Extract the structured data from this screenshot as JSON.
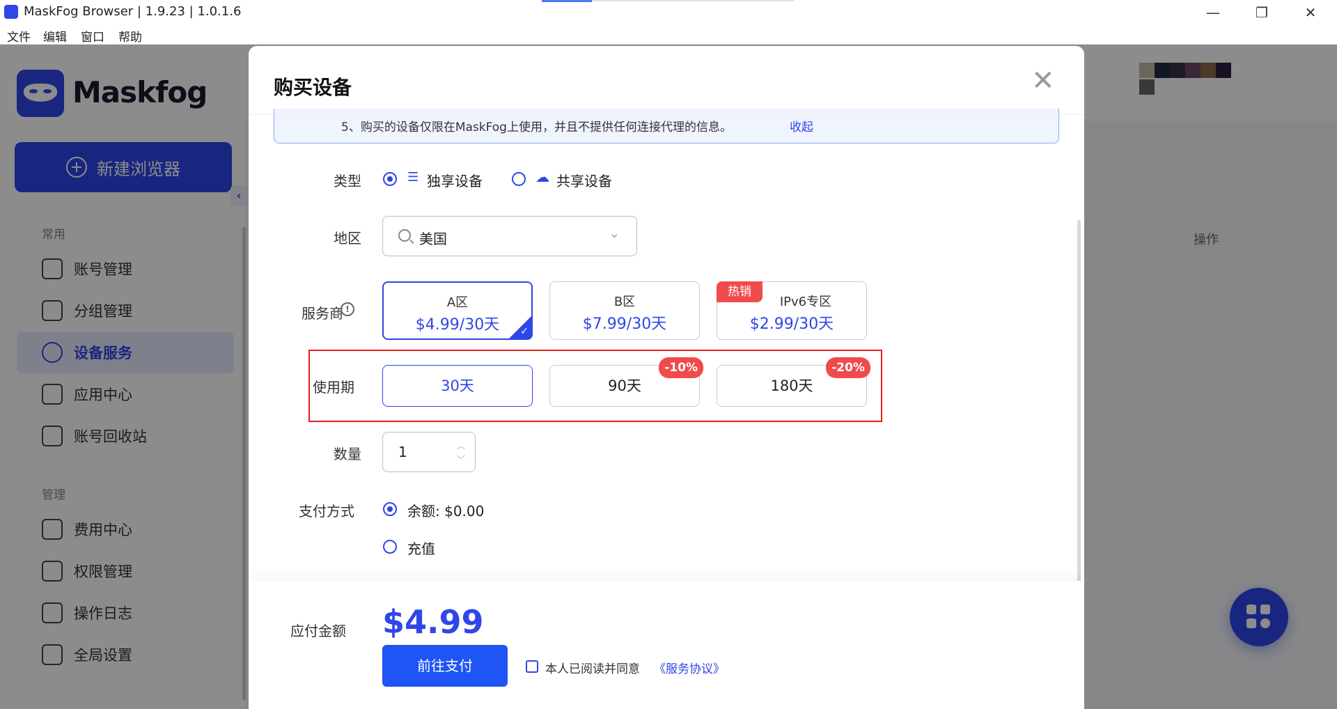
{
  "window": {
    "title": "MaskFog Browser | 1.9.23 | 1.0.1.6",
    "minimize_icon": "minimize-icon",
    "maximize_icon": "restore-icon",
    "close_icon": "close-icon"
  },
  "menu": [
    "文件",
    "编辑",
    "窗口",
    "帮助"
  ],
  "sidebar": {
    "logo": "Maskfog",
    "new_button": "新建浏览器",
    "sections": [
      {
        "title": "常用",
        "items": [
          {
            "label": "账号管理",
            "icon": "account-list-icon",
            "active": false
          },
          {
            "label": "分组管理",
            "icon": "folder-icon",
            "active": false
          },
          {
            "label": "设备服务",
            "icon": "location-pin-icon",
            "active": true
          },
          {
            "label": "应用中心",
            "icon": "cube-icon",
            "active": false
          },
          {
            "label": "账号回收站",
            "icon": "trash-icon",
            "active": false
          }
        ]
      },
      {
        "title": "管理",
        "items": [
          {
            "label": "费用中心",
            "icon": "receipt-dollar-icon",
            "active": false
          },
          {
            "label": "权限管理",
            "icon": "shield-key-icon",
            "active": false
          },
          {
            "label": "操作日志",
            "icon": "clipboard-icon",
            "active": false
          },
          {
            "label": "全局设置",
            "icon": "settings-hex-icon",
            "active": false
          }
        ]
      }
    ]
  },
  "main": {
    "table_op_header": "操作"
  },
  "modal": {
    "title": "购买设备",
    "notice": "5、购买的设备仅限在MaskFog上使用，并且不提供任何连接代理的信息。",
    "notice_link": "收起",
    "type_label": "类型",
    "type_options": [
      {
        "label": "独享设备",
        "icon": "server-stack-icon",
        "selected": true
      },
      {
        "label": "共享设备",
        "icon": "cloud-share-icon",
        "selected": false
      }
    ],
    "region_label": "地区",
    "region_value": "美国",
    "provider_label": "服务商",
    "providers": [
      {
        "name": "A区",
        "price": "$4.99/30天",
        "selected": true,
        "badge": ""
      },
      {
        "name": "B区",
        "price": "$7.99/30天",
        "selected": false,
        "badge": ""
      },
      {
        "name": "IPv6专区",
        "price": "$2.99/30天",
        "selected": false,
        "badge": "热销"
      }
    ],
    "period_label": "使用期",
    "periods": [
      {
        "label": "30天",
        "discount": "",
        "selected": true
      },
      {
        "label": "90天",
        "discount": "-10%",
        "selected": false
      },
      {
        "label": "180天",
        "discount": "-20%",
        "selected": false
      }
    ],
    "qty_label": "数量",
    "qty_value": "1",
    "payment_label": "支付方式",
    "payment_options": [
      {
        "label": "余额: $0.00",
        "selected": true
      },
      {
        "label": "充值",
        "selected": false
      }
    ],
    "total_label": "应付金额",
    "total_value": "$4.99",
    "pay_button": "前往支付",
    "agree_text": "本人已阅读并同意",
    "agree_link": "《服务协议》"
  },
  "colors": {
    "accent": "#2f46e8",
    "danger": "#f04b4b",
    "highlight_box": "#e2231a"
  }
}
